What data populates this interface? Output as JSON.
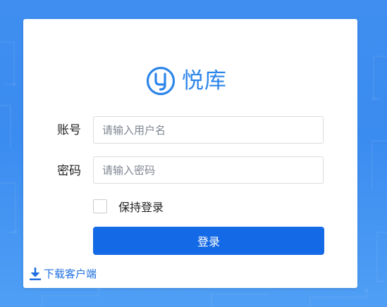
{
  "brand": {
    "logo_icon": "yueku-logo-icon",
    "name": "悦库",
    "color": "#2d86ea"
  },
  "form": {
    "username": {
      "label": "账号",
      "placeholder": "请输入用户名",
      "value": ""
    },
    "password": {
      "label": "密码",
      "placeholder": "请输入密码",
      "value": ""
    },
    "remember": {
      "label": "保持登录",
      "checked": false
    },
    "submit_label": "登录"
  },
  "footer": {
    "download_icon": "download-icon",
    "download_label": "下载客户端"
  },
  "colors": {
    "background": "#3f8ef0",
    "primary_button": "#1469e6",
    "link": "#1f6fe0"
  }
}
